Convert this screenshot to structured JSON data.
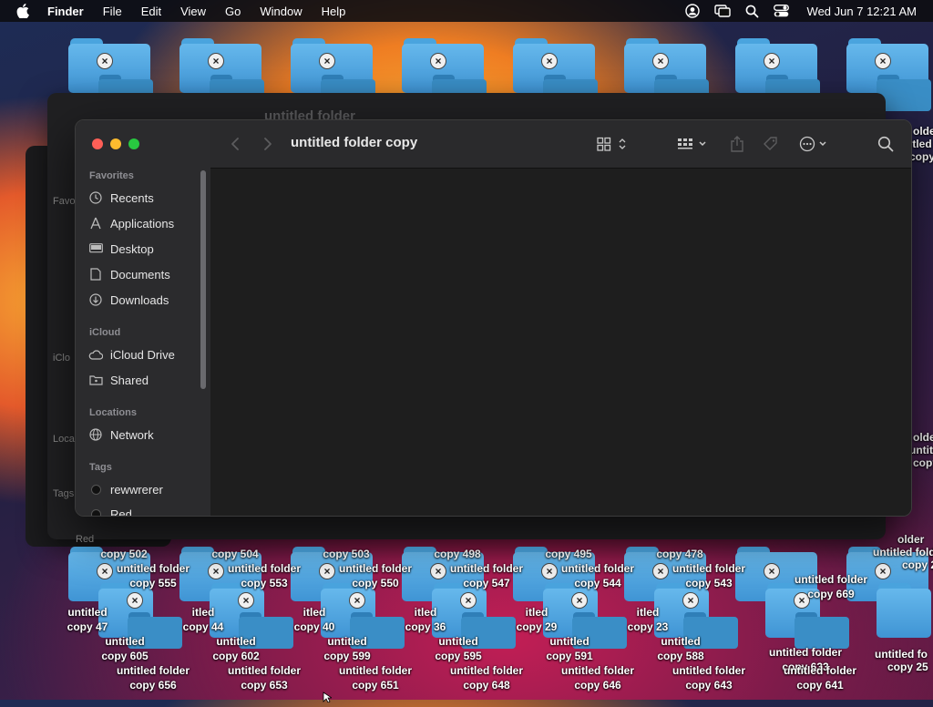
{
  "menubar": {
    "app": "Finder",
    "items": [
      "File",
      "Edit",
      "View",
      "Go",
      "Window",
      "Help"
    ],
    "datetime": "Wed Jun 7  12:21 AM"
  },
  "window": {
    "title": "untitled folder copy",
    "behind_title": "untitled folder"
  },
  "sidebar": {
    "favorites_header": "Favorites",
    "favorites": [
      "Recents",
      "Applications",
      "Desktop",
      "Documents",
      "Downloads"
    ],
    "icloud_header": "iCloud",
    "icloud": [
      "iCloud Drive",
      "Shared"
    ],
    "locations_header": "Locations",
    "locations": [
      "Network"
    ],
    "tags_header": "Tags",
    "tags": [
      "rewwrerer",
      "Red"
    ]
  },
  "behind_sidebar": {
    "favorites": "Favo",
    "icloud": "iClo",
    "locations": "Loca",
    "tags": "Tags",
    "red": "Red"
  },
  "desktop": {
    "labels_top": [
      "copy 502",
      "copy 504",
      "copy 503",
      "copy 498",
      "copy 495",
      "copy 478"
    ],
    "labels_row1": [
      "untitled folder\ncopy 555",
      "untitled folder\ncopy 553",
      "untitled folder\ncopy 550",
      "untitled folder\ncopy 547",
      "untitled folder\ncopy 544",
      "untitled folder\ncopy 543"
    ],
    "labels_row2": [
      "untitled\ncopy 47",
      "itled\ncopy 44",
      "itled\ncopy 40",
      "itled\ncopy 36",
      "itled\ncopy 29",
      "itled\ncopy 23"
    ],
    "labels_row3": [
      "untitled\ncopy 605",
      "untitled\ncopy 602",
      "untitled\ncopy 599",
      "untitled\ncopy 595",
      "untitled\ncopy 591",
      "untitled\ncopy 588"
    ],
    "labels_bottom": [
      "untitled folder\ncopy 656",
      "untitled folder\ncopy 653",
      "untitled folder\ncopy 651",
      "untitled folder\ncopy 648",
      "untitled folder\ncopy 646",
      "untitled folder\ncopy 643",
      "untitled folder\ncopy 641"
    ],
    "labels_right_cluster": [
      "untitled folder\ncopy 669",
      "untitled folder\ncopy 633"
    ],
    "labels_far_right": [
      "olde",
      "itled fo",
      "copy 690",
      "olde",
      "untitled fo",
      "copy 25",
      "older",
      "untitled folder",
      "copy 254",
      "untitled fo",
      "copy 25"
    ]
  },
  "colors": {
    "folder_blue": "#4aa4de",
    "close": "#ff5f57",
    "minimize": "#febc2e",
    "zoom": "#28c840"
  }
}
